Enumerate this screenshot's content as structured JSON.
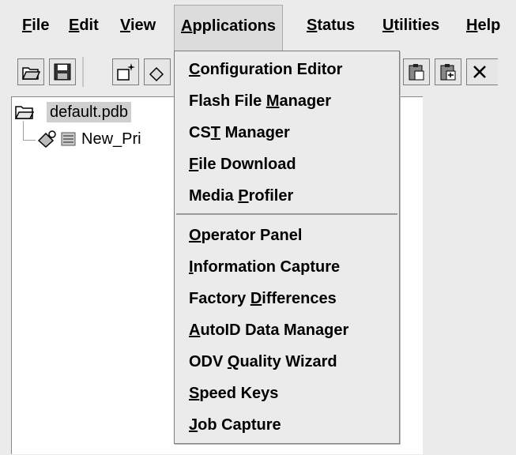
{
  "menubar": {
    "items": [
      {
        "pre": "",
        "u": "F",
        "post": "ile"
      },
      {
        "pre": "",
        "u": "E",
        "post": "dit"
      },
      {
        "pre": "",
        "u": "V",
        "post": "iew"
      },
      {
        "pre": "",
        "u": "A",
        "post": "pplications"
      },
      {
        "pre": "",
        "u": "S",
        "post": "tatus"
      },
      {
        "pre": "",
        "u": "U",
        "post": "tilities"
      },
      {
        "pre": "",
        "u": "H",
        "post": "elp"
      }
    ]
  },
  "toolbar": {
    "icons": [
      "open-folder-icon",
      "save-disk-icon",
      "new-item-icon",
      "add-item-icon",
      "paste-icon",
      "paste-special-icon",
      "delete-icon"
    ]
  },
  "tree": {
    "root": "default.pdb",
    "child": "New_Pri"
  },
  "dropdown": {
    "items": [
      {
        "pre": "",
        "u": "C",
        "post": "onfiguration Editor"
      },
      {
        "pre": "Flash File ",
        "u": "M",
        "post": "anager"
      },
      {
        "pre": "CS",
        "u": "T",
        "post": " Manager"
      },
      {
        "pre": "",
        "u": "F",
        "post": "ile Download"
      },
      {
        "pre": "Media ",
        "u": "P",
        "post": "rofiler"
      },
      {
        "pre": "",
        "u": "O",
        "post": "perator Panel"
      },
      {
        "pre": "",
        "u": "I",
        "post": "nformation Capture"
      },
      {
        "pre": "Factory ",
        "u": "D",
        "post": "ifferences"
      },
      {
        "pre": "",
        "u": "A",
        "post": "utoID Data Manager"
      },
      {
        "pre": "ODV ",
        "u": "Q",
        "post": "uality Wizard"
      },
      {
        "pre": "",
        "u": "S",
        "post": "peed Keys"
      },
      {
        "pre": "",
        "u": "J",
        "post": "ob Capture"
      }
    ]
  }
}
